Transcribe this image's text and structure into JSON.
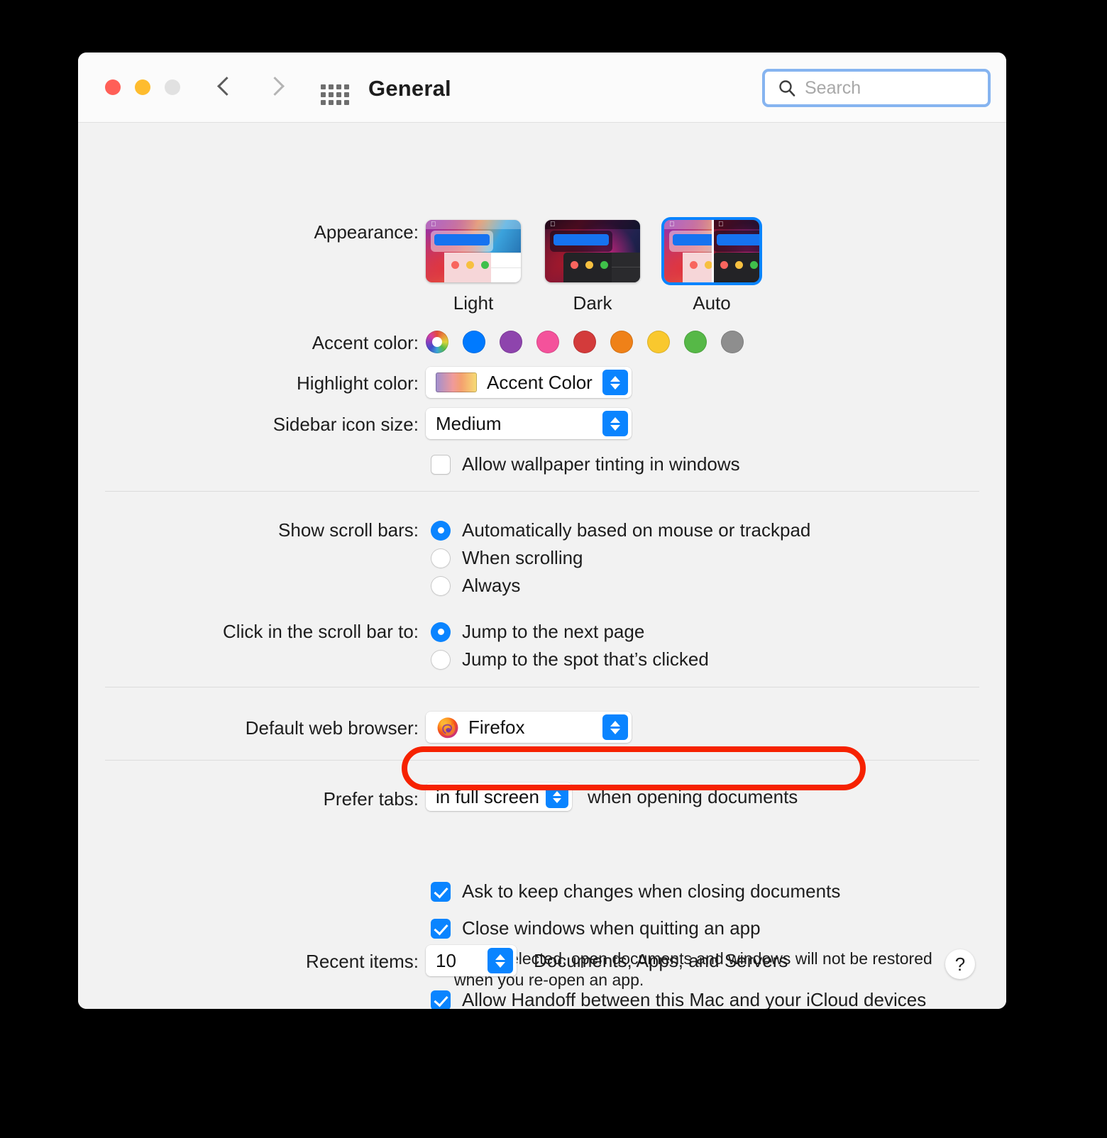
{
  "window": {
    "title": "General",
    "traffic_lights": [
      "close-button",
      "minimize-button",
      "zoom-button"
    ],
    "nav": {
      "back": "back-chevron",
      "forward": "forward-chevron",
      "show_all": "show-all-grid-icon"
    },
    "search": {
      "placeholder": "Search",
      "value": "",
      "icon": "search-icon"
    }
  },
  "labels": {
    "appearance": "Appearance:",
    "accent_color": "Accent color:",
    "highlight_color": "Highlight color:",
    "sidebar_icon_size": "Sidebar icon size:",
    "show_scroll_bars": "Show scroll bars:",
    "click_scroll_bar": "Click in the scroll bar to:",
    "default_web_browser": "Default web browser:",
    "prefer_tabs": "Prefer tabs:",
    "recent_items": "Recent items:"
  },
  "appearance": {
    "options": [
      {
        "name": "Light",
        "selected": false
      },
      {
        "name": "Dark",
        "selected": false
      },
      {
        "name": "Auto",
        "selected": true
      }
    ]
  },
  "accent_colors": [
    {
      "name": "multicolor",
      "hex": "multicolor",
      "selected": false
    },
    {
      "name": "blue",
      "hex": "#007aff",
      "selected": false
    },
    {
      "name": "purple",
      "hex": "#8e44ad",
      "selected": false
    },
    {
      "name": "pink",
      "hex": "#f4529b",
      "selected": false
    },
    {
      "name": "red",
      "hex": "#d33b3b",
      "selected": false
    },
    {
      "name": "orange",
      "hex": "#ef8118",
      "selected": false
    },
    {
      "name": "yellow",
      "hex": "#f9c82e",
      "selected": false
    },
    {
      "name": "green",
      "hex": "#54b council",
      "selected": false
    },
    {
      "name": "graphite",
      "hex": "#8e8e8e",
      "selected": false
    }
  ],
  "highlight_color": {
    "value": "Accent Color"
  },
  "sidebar_icon_size": {
    "value": "Medium"
  },
  "wallpaper_tinting": {
    "label": "Allow wallpaper tinting in windows",
    "checked": false
  },
  "scroll_bars": {
    "options": [
      {
        "label": "Automatically based on mouse or trackpad",
        "selected": true
      },
      {
        "label": "When scrolling",
        "selected": false
      },
      {
        "label": "Always",
        "selected": false
      }
    ]
  },
  "scroll_bar_click": {
    "options": [
      {
        "label": "Jump to the next page",
        "selected": true
      },
      {
        "label": "Jump to the spot that’s clicked",
        "selected": false
      }
    ]
  },
  "default_browser": {
    "value": "Firefox",
    "icon": "firefox-icon"
  },
  "prefer_tabs": {
    "value": "in full screen",
    "suffix": "when opening documents"
  },
  "checkboxes": {
    "ask_keep_changes": {
      "label": "Ask to keep changes when closing documents",
      "checked": true,
      "highlighted": true
    },
    "close_windows": {
      "label": "Close windows when quitting an app",
      "checked": true
    },
    "close_windows_help": "When selected, open documents and windows will not be restored when you re-open an app.",
    "handoff": {
      "label": "Allow Handoff between this Mac and your iCloud devices",
      "checked": true
    }
  },
  "recent_items": {
    "value": "10",
    "suffix": "Documents, Apps, and Servers"
  },
  "help_button": {
    "label": "?"
  },
  "annotation": {
    "color": "#f62200",
    "target": "ask-to-keep-changes-checkbox"
  }
}
